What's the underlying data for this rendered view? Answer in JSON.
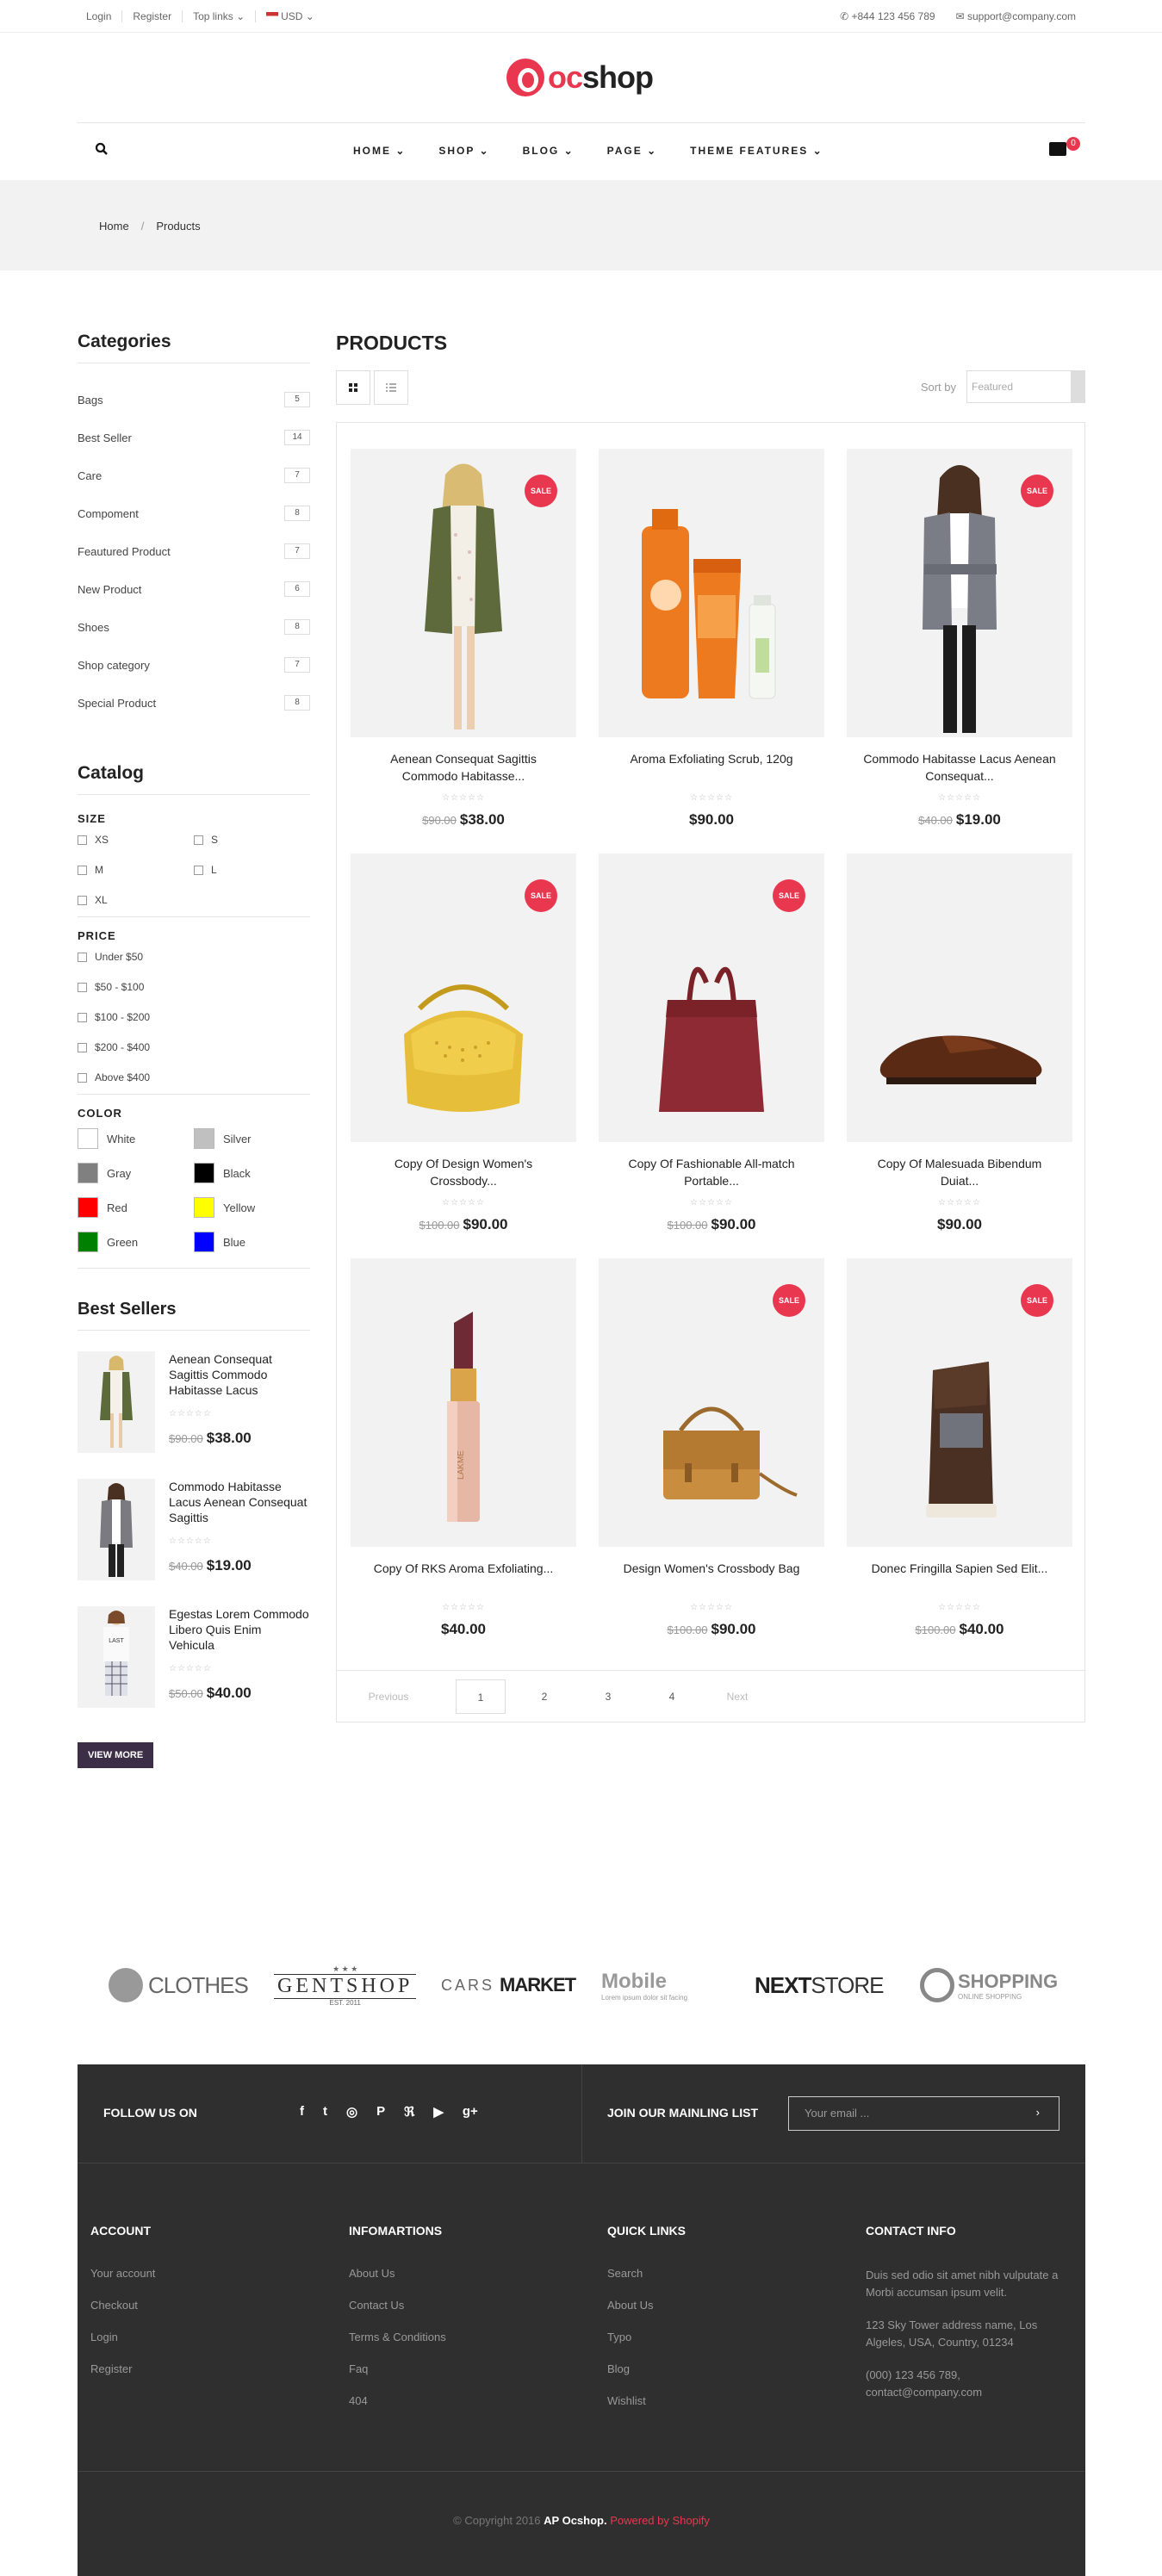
{
  "topbar": {
    "login": "Login",
    "register": "Register",
    "toplinks": "Top links ⌄",
    "currency": "USD ⌄",
    "phone": "+844 123 456 789",
    "email": "support@company.com"
  },
  "logo": {
    "oc": "oc",
    "shop": "shop"
  },
  "nav": {
    "items": [
      "HOME ⌄",
      "SHOP ⌄",
      "BLOG ⌄",
      "PAGE ⌄",
      "THEME FEATURES ⌄"
    ],
    "cart_count": "0"
  },
  "breadcrumb": {
    "home": "Home",
    "sep": "/",
    "current": "Products"
  },
  "categories": {
    "title": "Categories",
    "items": [
      {
        "name": "Bags",
        "count": "5"
      },
      {
        "name": "Best Seller",
        "count": "14"
      },
      {
        "name": "Care",
        "count": "7"
      },
      {
        "name": "Compoment",
        "count": "8"
      },
      {
        "name": "Feautured Product",
        "count": "7"
      },
      {
        "name": "New Product",
        "count": "6"
      },
      {
        "name": "Shoes",
        "count": "8"
      },
      {
        "name": "Shop category",
        "count": "7"
      },
      {
        "name": "Special Product",
        "count": "8"
      }
    ]
  },
  "catalog": {
    "title": "Catalog",
    "size_title": "SIZE",
    "sizes": [
      "XS",
      "S",
      "M",
      "L",
      "XL"
    ],
    "price_title": "PRICE",
    "prices": [
      "Under $50",
      "$50 - $100",
      "$100 - $200",
      "$200 - $400",
      "Above $400"
    ],
    "color_title": "COLOR",
    "colors": [
      {
        "name": "White",
        "hex": "#ffffff"
      },
      {
        "name": "Silver",
        "hex": "#c0c0c0"
      },
      {
        "name": "Gray",
        "hex": "#808080"
      },
      {
        "name": "Black",
        "hex": "#000000"
      },
      {
        "name": "Red",
        "hex": "#ff0000"
      },
      {
        "name": "Yellow",
        "hex": "#ffff00"
      },
      {
        "name": "Green",
        "hex": "#008000"
      },
      {
        "name": "Blue",
        "hex": "#0000ff"
      }
    ]
  },
  "bestsellers": {
    "title": "Best Sellers",
    "items": [
      {
        "name": "Aenean Consequat Sagittis Commodo Habitasse Lacus",
        "old": "$90.00",
        "price": "$38.00"
      },
      {
        "name": "Commodo Habitasse Lacus Aenean Consequat Sagittis",
        "old": "$40.00",
        "price": "$19.00"
      },
      {
        "name": "Egestas Lorem Commodo Libero Quis Enim Vehicula",
        "old": "$50.00",
        "price": "$40.00"
      }
    ],
    "view_more": "VIEW MORE"
  },
  "products": {
    "title": "PRODUCTS",
    "sort_label": "Sort by",
    "sort_value": "Featured",
    "sale": "SALE",
    "stars": "☆☆☆☆☆",
    "items": [
      {
        "name": "Aenean Consequat Sagittis Commodo Habitasse...",
        "old": "$90.00",
        "price": "$38.00",
        "sale": true
      },
      {
        "name": "Aroma Exfoliating Scrub, 120g",
        "old": "",
        "price": "$90.00",
        "sale": false
      },
      {
        "name": "Commodo Habitasse Lacus Aenean Consequat...",
        "old": "$40.00",
        "price": "$19.00",
        "sale": true
      },
      {
        "name": "Copy Of Design Women's Crossbody...",
        "old": "$100.00",
        "price": "$90.00",
        "sale": true
      },
      {
        "name": "Copy Of Fashionable All-match Portable...",
        "old": "$100.00",
        "price": "$90.00",
        "sale": true
      },
      {
        "name": "Copy Of Malesuada Bibendum Duiat...",
        "old": "",
        "price": "$90.00",
        "sale": false
      },
      {
        "name": "Copy Of RKS Aroma Exfoliating...",
        "old": "",
        "price": "$40.00",
        "sale": false
      },
      {
        "name": "Design Women's Crossbody Bag",
        "old": "$100.00",
        "price": "$90.00",
        "sale": true
      },
      {
        "name": "Donec Fringilla Sapien Sed Elit...",
        "old": "$100.00",
        "price": "$40.00",
        "sale": true
      }
    ]
  },
  "pager": {
    "prev": "Previous",
    "pages": [
      "1",
      "2",
      "3",
      "4"
    ],
    "next": "Next"
  },
  "brands": {
    "clothes": "CLOTHES",
    "gentshop": "GENTSHOP",
    "gentshop_sub": "EST. 2011",
    "cars": "CARS",
    "market": "MARKET",
    "mobile": "Mobile",
    "mobile_sub": "Lorem ipsum dolor sit facing",
    "next": "NEXT",
    "store": "STORE",
    "shopping": "SHOPPING",
    "shopping_sub": "ONLINE SHOPPING"
  },
  "footer": {
    "follow": "FOLLOW US ON",
    "social": [
      "f",
      "t",
      "◎",
      "P",
      "ℜ",
      "▶",
      "g+"
    ],
    "join": "JOIN OUR MAINLING LIST",
    "email_placeholder": "Your email ...",
    "go": "›",
    "account": {
      "title": "ACCOUNT",
      "links": [
        "Your account",
        "Checkout",
        "Login",
        "Register"
      ]
    },
    "info": {
      "title": "INFOMARTIONS",
      "links": [
        "About Us",
        "Contact Us",
        "Terms & Conditions",
        "Faq",
        "404"
      ]
    },
    "quick": {
      "title": "QUICK LINKS",
      "links": [
        "Search",
        "About Us",
        "Typo",
        "Blog",
        "Wishlist"
      ]
    },
    "contact": {
      "title": "CONTACT INFO",
      "desc": "Duis sed odio sit amet nibh vulputate a Morbi accumsan ipsum velit.",
      "address": "123 Sky Tower address name, Los Algeles, USA, Country, 01234",
      "phone": "(000) 123 456 789,",
      "email": "contact@company.com"
    },
    "copy1": "© Copyright 2016",
    "copy2": "AP Ocshop.",
    "copy3": "Powered by Shopify"
  }
}
